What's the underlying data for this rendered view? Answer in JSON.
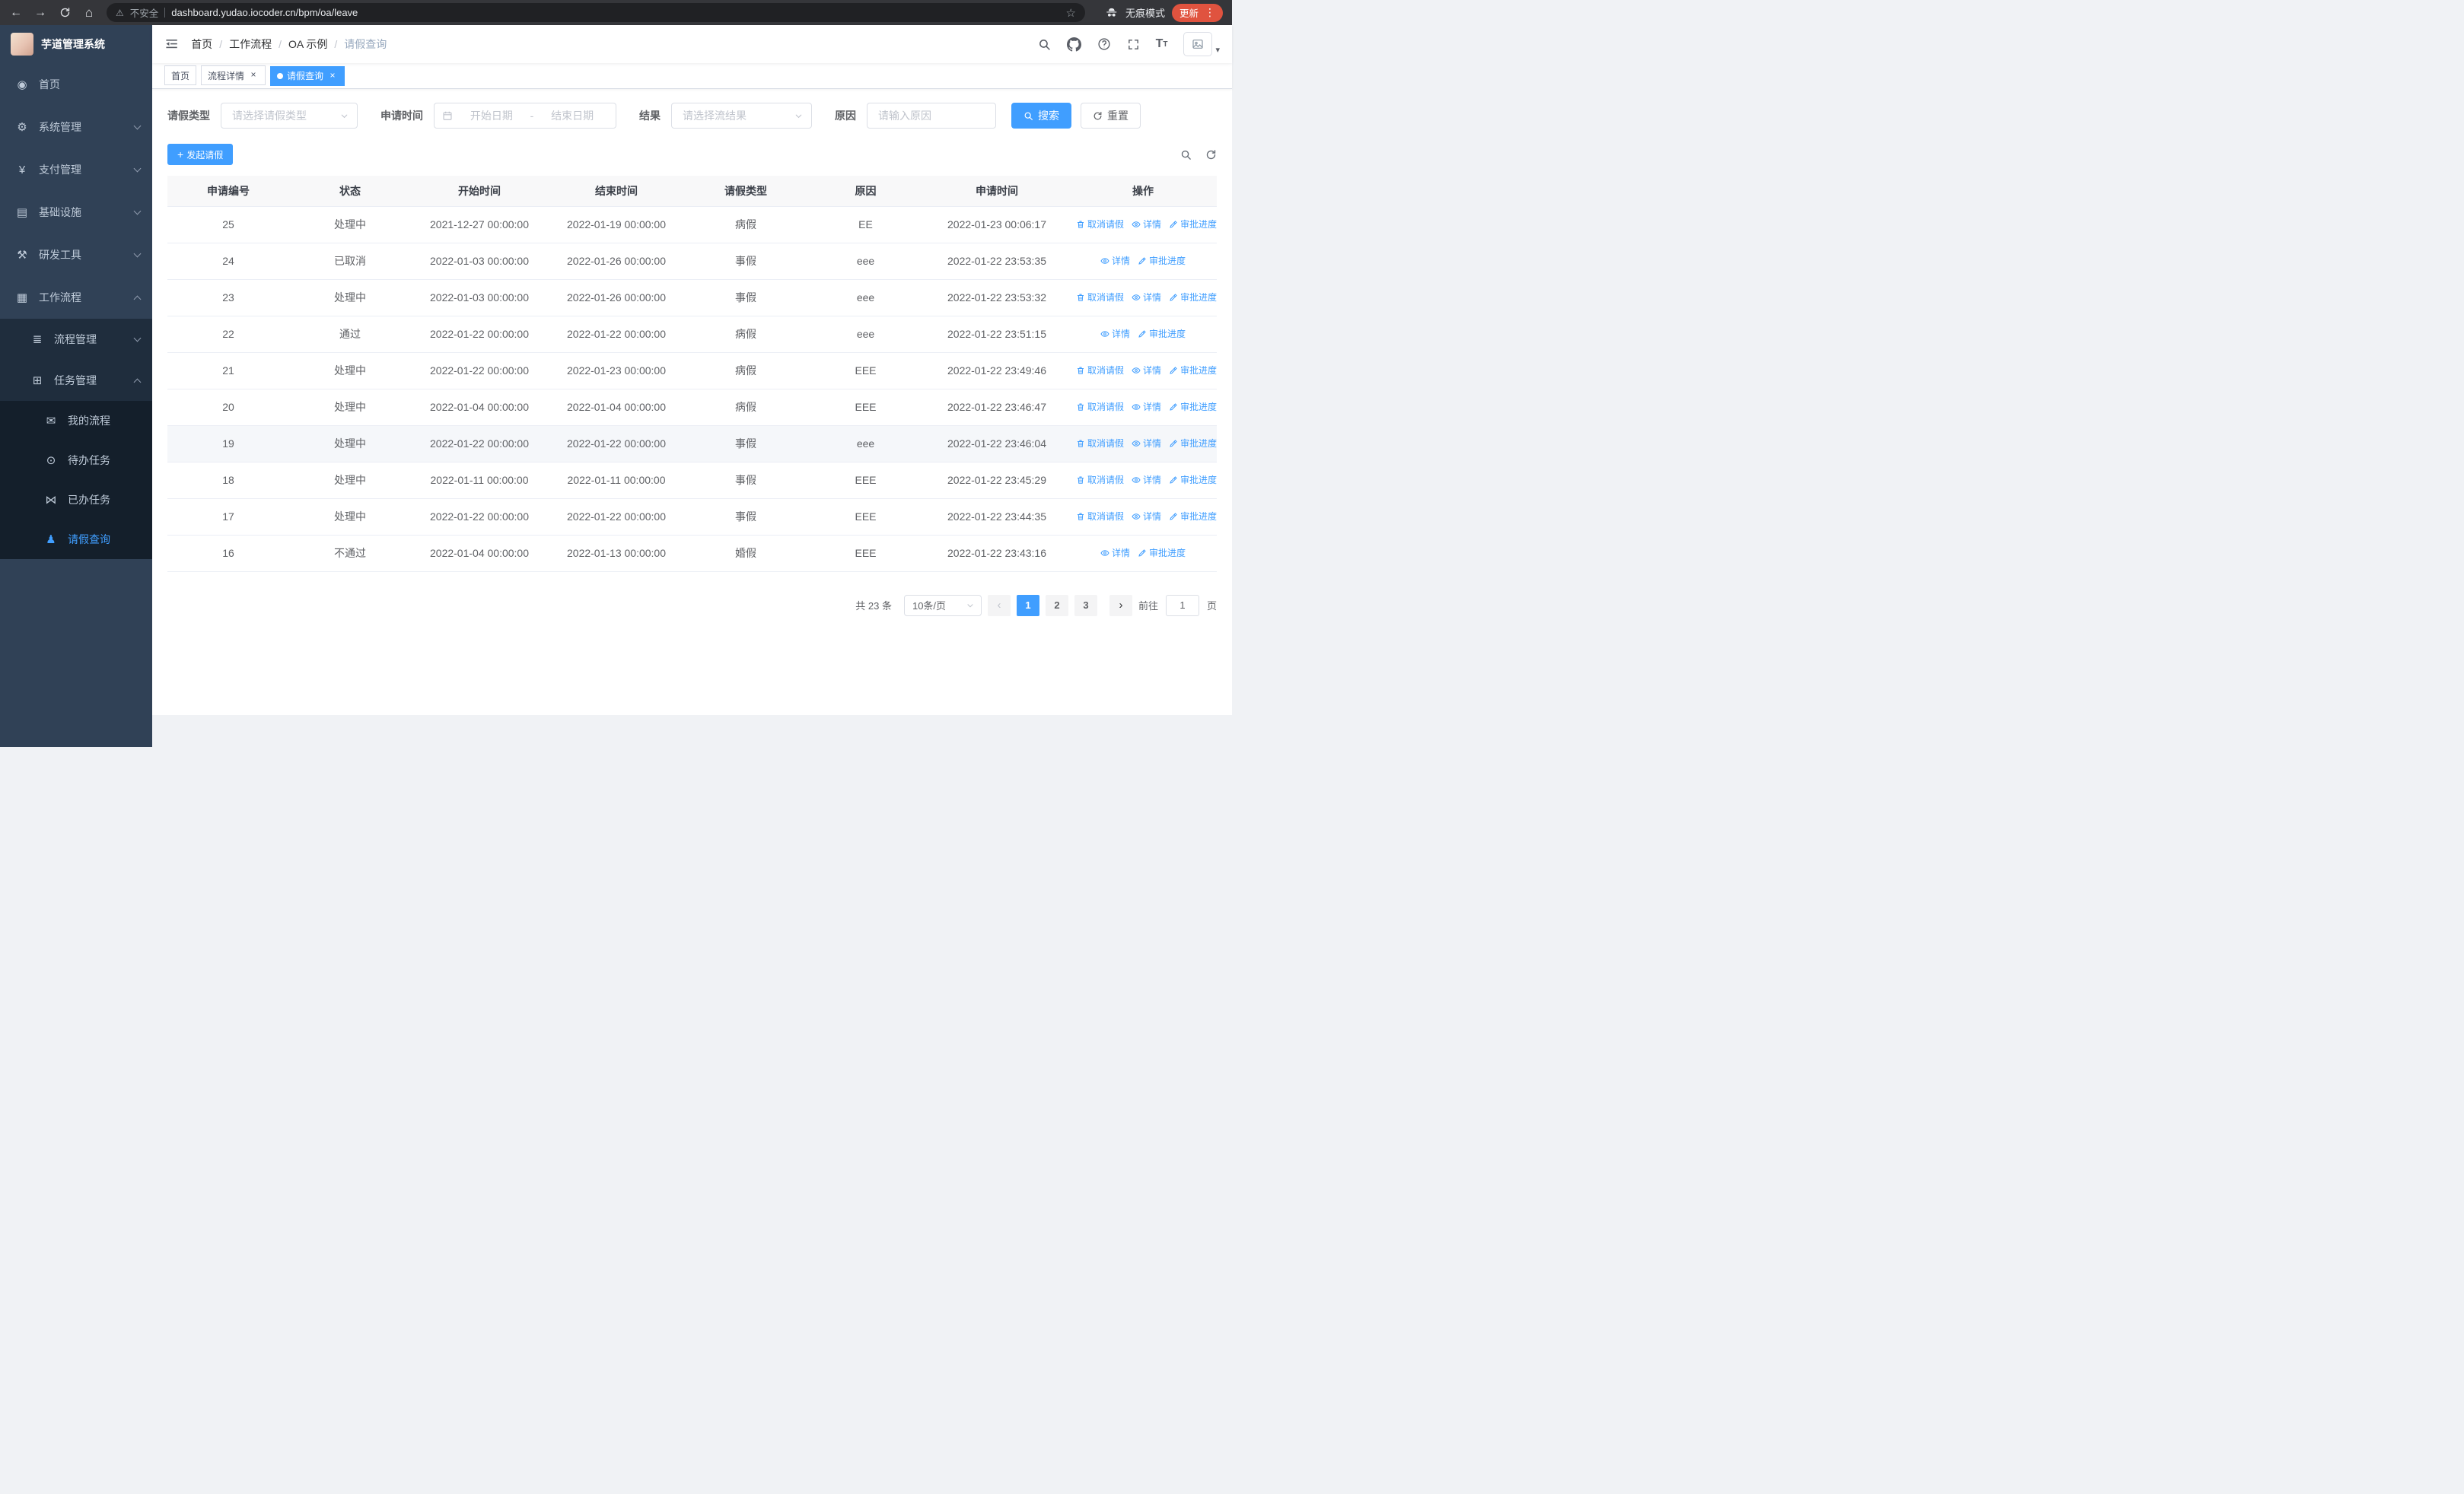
{
  "browser": {
    "security_label": "不安全",
    "url": "dashboard.yudao.iocoder.cn/bpm/oa/leave",
    "incognito_label": "无痕模式",
    "update_label": "更新"
  },
  "app": {
    "logo_title": "芋道管理系统"
  },
  "sidebar": {
    "menu": [
      {
        "id": "home",
        "label": "首页",
        "icon": "dashboard-icon",
        "glyph": "◉",
        "level": 1
      },
      {
        "id": "system",
        "label": "系统管理",
        "icon": "gear-icon",
        "glyph": "⚙",
        "level": 1,
        "chevron": "down"
      },
      {
        "id": "payment",
        "label": "支付管理",
        "icon": "yen-icon",
        "glyph": "¥",
        "level": 1,
        "chevron": "down"
      },
      {
        "id": "infrastructure",
        "label": "基础设施",
        "icon": "server-icon",
        "glyph": "▤",
        "level": 1,
        "chevron": "down"
      },
      {
        "id": "devtools",
        "label": "研发工具",
        "icon": "tools-icon",
        "glyph": "⚒",
        "level": 1,
        "chevron": "down"
      },
      {
        "id": "workflow",
        "label": "工作流程",
        "icon": "briefcase-icon",
        "glyph": "▦",
        "level": 1,
        "chevron": "up"
      },
      {
        "id": "process-mgmt",
        "label": "流程管理",
        "icon": "list-icon",
        "glyph": "≣",
        "level": 2,
        "chevron": "down"
      },
      {
        "id": "task-mgmt",
        "label": "任务管理",
        "icon": "tasks-icon",
        "glyph": "⊞",
        "level": 2,
        "chevron": "up"
      },
      {
        "id": "my-process",
        "label": "我的流程",
        "icon": "message-icon",
        "glyph": "✉",
        "level": 3
      },
      {
        "id": "todo-tasks",
        "label": "待办任务",
        "icon": "eye-icon",
        "glyph": "⊙",
        "level": 3
      },
      {
        "id": "done-tasks",
        "label": "已办任务",
        "icon": "scissors-icon",
        "glyph": "⋈",
        "level": 3
      },
      {
        "id": "leave-query",
        "label": "请假查询",
        "icon": "user-icon",
        "glyph": "♟",
        "level": 3,
        "active": true
      }
    ]
  },
  "header": {
    "breadcrumb": [
      "首页",
      "工作流程",
      "OA 示例",
      "请假查询"
    ]
  },
  "tabs": [
    {
      "label": "首页",
      "active": false,
      "closable": false
    },
    {
      "label": "流程详情",
      "active": false,
      "closable": true
    },
    {
      "label": "请假查询",
      "active": true,
      "closable": true
    }
  ],
  "filters": {
    "leave_type_label": "请假类型",
    "leave_type_placeholder": "请选择请假类型",
    "apply_time_label": "申请时间",
    "date_start_placeholder": "开始日期",
    "date_separator": "-",
    "date_end_placeholder": "结束日期",
    "result_label": "结果",
    "result_placeholder": "请选择流结果",
    "reason_label": "原因",
    "reason_placeholder": "请输入原因",
    "search_button": "搜索",
    "reset_button": "重置"
  },
  "toolbar": {
    "create_button": "发起请假"
  },
  "table": {
    "columns": [
      "申请编号",
      "状态",
      "开始时间",
      "结束时间",
      "请假类型",
      "原因",
      "申请时间",
      "操作"
    ],
    "action_labels": {
      "cancel": "取消请假",
      "detail": "详情",
      "progress": "审批进度"
    },
    "rows": [
      {
        "id": "25",
        "status": "处理中",
        "start": "2021-12-27 00:00:00",
        "end": "2022-01-19 00:00:00",
        "type": "病假",
        "reason": "EE",
        "apply_time": "2022-01-23 00:06:17",
        "actions": [
          "cancel",
          "detail",
          "progress"
        ]
      },
      {
        "id": "24",
        "status": "已取消",
        "start": "2022-01-03 00:00:00",
        "end": "2022-01-26 00:00:00",
        "type": "事假",
        "reason": "eee",
        "apply_time": "2022-01-22 23:53:35",
        "actions": [
          "detail",
          "progress"
        ]
      },
      {
        "id": "23",
        "status": "处理中",
        "start": "2022-01-03 00:00:00",
        "end": "2022-01-26 00:00:00",
        "type": "事假",
        "reason": "eee",
        "apply_time": "2022-01-22 23:53:32",
        "actions": [
          "cancel",
          "detail",
          "progress"
        ]
      },
      {
        "id": "22",
        "status": "通过",
        "start": "2022-01-22 00:00:00",
        "end": "2022-01-22 00:00:00",
        "type": "病假",
        "reason": "eee",
        "apply_time": "2022-01-22 23:51:15",
        "actions": [
          "detail",
          "progress"
        ]
      },
      {
        "id": "21",
        "status": "处理中",
        "start": "2022-01-22 00:00:00",
        "end": "2022-01-23 00:00:00",
        "type": "病假",
        "reason": "EEE",
        "apply_time": "2022-01-22 23:49:46",
        "actions": [
          "cancel",
          "detail",
          "progress"
        ]
      },
      {
        "id": "20",
        "status": "处理中",
        "start": "2022-01-04 00:00:00",
        "end": "2022-01-04 00:00:00",
        "type": "病假",
        "reason": "EEE",
        "apply_time": "2022-01-22 23:46:47",
        "actions": [
          "cancel",
          "detail",
          "progress"
        ]
      },
      {
        "id": "19",
        "status": "处理中",
        "start": "2022-01-22 00:00:00",
        "end": "2022-01-22 00:00:00",
        "type": "事假",
        "reason": "eee",
        "apply_time": "2022-01-22 23:46:04",
        "actions": [
          "cancel",
          "detail",
          "progress"
        ],
        "hover": true
      },
      {
        "id": "18",
        "status": "处理中",
        "start": "2022-01-11 00:00:00",
        "end": "2022-01-11 00:00:00",
        "type": "事假",
        "reason": "EEE",
        "apply_time": "2022-01-22 23:45:29",
        "actions": [
          "cancel",
          "detail",
          "progress"
        ]
      },
      {
        "id": "17",
        "status": "处理中",
        "start": "2022-01-22 00:00:00",
        "end": "2022-01-22 00:00:00",
        "type": "事假",
        "reason": "EEE",
        "apply_time": "2022-01-22 23:44:35",
        "actions": [
          "cancel",
          "detail",
          "progress"
        ]
      },
      {
        "id": "16",
        "status": "不通过",
        "start": "2022-01-04 00:00:00",
        "end": "2022-01-13 00:00:00",
        "type": "婚假",
        "reason": "EEE",
        "apply_time": "2022-01-22 23:43:16",
        "actions": [
          "detail",
          "progress"
        ]
      }
    ]
  },
  "pagination": {
    "total_text": "共 23 条",
    "page_size": "10条/页",
    "pages": [
      "1",
      "2",
      "3"
    ],
    "active_page": "1",
    "goto_label": "前往",
    "goto_value": "1",
    "goto_suffix": "页"
  },
  "colors": {
    "primary": "#409eff",
    "sidebar_bg": "#304156",
    "sidebar_sub_bg": "#1f2d3d",
    "sidebar_deep_bg": "#141f2b",
    "update_badge": "#e0533f",
    "table_header_bg": "#f8f8f9"
  }
}
